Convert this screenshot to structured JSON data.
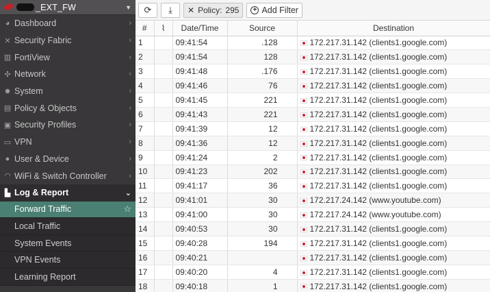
{
  "app": {
    "device_name": "_EXT_FW"
  },
  "sidebar": {
    "items": [
      {
        "label": "Dashboard",
        "icon": "dashboard-icon"
      },
      {
        "label": "Security Fabric",
        "icon": "fabric-icon"
      },
      {
        "label": "FortiView",
        "icon": "fortiview-icon"
      },
      {
        "label": "Network",
        "icon": "network-icon"
      },
      {
        "label": "System",
        "icon": "gear-icon"
      },
      {
        "label": "Policy & Objects",
        "icon": "policy-icon"
      },
      {
        "label": "Security Profiles",
        "icon": "lock-icon"
      },
      {
        "label": "VPN",
        "icon": "monitor-icon"
      },
      {
        "label": "User & Device",
        "icon": "user-icon"
      },
      {
        "label": "WiFi & Switch Controller",
        "icon": "wifi-icon"
      },
      {
        "label": "Log & Report",
        "icon": "chart-icon"
      }
    ],
    "sub_items": [
      {
        "label": "Forward Traffic"
      },
      {
        "label": "Local Traffic"
      },
      {
        "label": "System Events"
      },
      {
        "label": "VPN Events"
      },
      {
        "label": "Learning Report"
      }
    ]
  },
  "toolbar": {
    "filter_label": "Policy:",
    "filter_value": "295",
    "add_filter_label": "Add Filter"
  },
  "table": {
    "columns": [
      "#",
      "",
      "Date/Time",
      "Source",
      "Destination"
    ],
    "rows": [
      {
        "num": "1",
        "time": "09:41:54",
        "source": ".128",
        "destination": "172.217.31.142 (clients1.google.com)"
      },
      {
        "num": "2",
        "time": "09:41:54",
        "source": "128",
        "destination": "172.217.31.142 (clients1.google.com)"
      },
      {
        "num": "3",
        "time": "09:41:48",
        "source": ".176",
        "destination": "172.217.31.142 (clients1.google.com)"
      },
      {
        "num": "4",
        "time": "09:41:46",
        "source": "76",
        "destination": "172.217.31.142 (clients1.google.com)"
      },
      {
        "num": "5",
        "time": "09:41:45",
        "source": "221",
        "destination": "172.217.31.142 (clients1.google.com)"
      },
      {
        "num": "6",
        "time": "09:41:43",
        "source": "221",
        "destination": "172.217.31.142 (clients1.google.com)"
      },
      {
        "num": "7",
        "time": "09:41:39",
        "source": "12",
        "destination": "172.217.31.142 (clients1.google.com)"
      },
      {
        "num": "8",
        "time": "09:41:36",
        "source": "12",
        "destination": "172.217.31.142 (clients1.google.com)"
      },
      {
        "num": "9",
        "time": "09:41:24",
        "source": "2",
        "destination": "172.217.31.142 (clients1.google.com)"
      },
      {
        "num": "10",
        "time": "09:41:23",
        "source": "202",
        "destination": "172.217.31.142 (clients1.google.com)"
      },
      {
        "num": "11",
        "time": "09:41:17",
        "source": "36",
        "destination": "172.217.31.142 (clients1.google.com)"
      },
      {
        "num": "12",
        "time": "09:41:01",
        "source": "30",
        "destination": "172.217.24.142 (www.youtube.com)"
      },
      {
        "num": "13",
        "time": "09:41:00",
        "source": "30",
        "destination": "172.217.24.142 (www.youtube.com)"
      },
      {
        "num": "14",
        "time": "09:40:53",
        "source": "30",
        "destination": "172.217.31.142 (clients1.google.com)"
      },
      {
        "num": "15",
        "time": "09:40:28",
        "source": "194",
        "destination": "172.217.31.142 (clients1.google.com)"
      },
      {
        "num": "16",
        "time": "09:40:21",
        "source": "",
        "destination": "172.217.31.142 (clients1.google.com)"
      },
      {
        "num": "17",
        "time": "09:40:20",
        "source": "4",
        "destination": "172.217.31.142 (clients1.google.com)"
      },
      {
        "num": "18",
        "time": "09:40:18",
        "source": "1",
        "destination": "172.217.31.142 (clients1.google.com)"
      }
    ]
  }
}
